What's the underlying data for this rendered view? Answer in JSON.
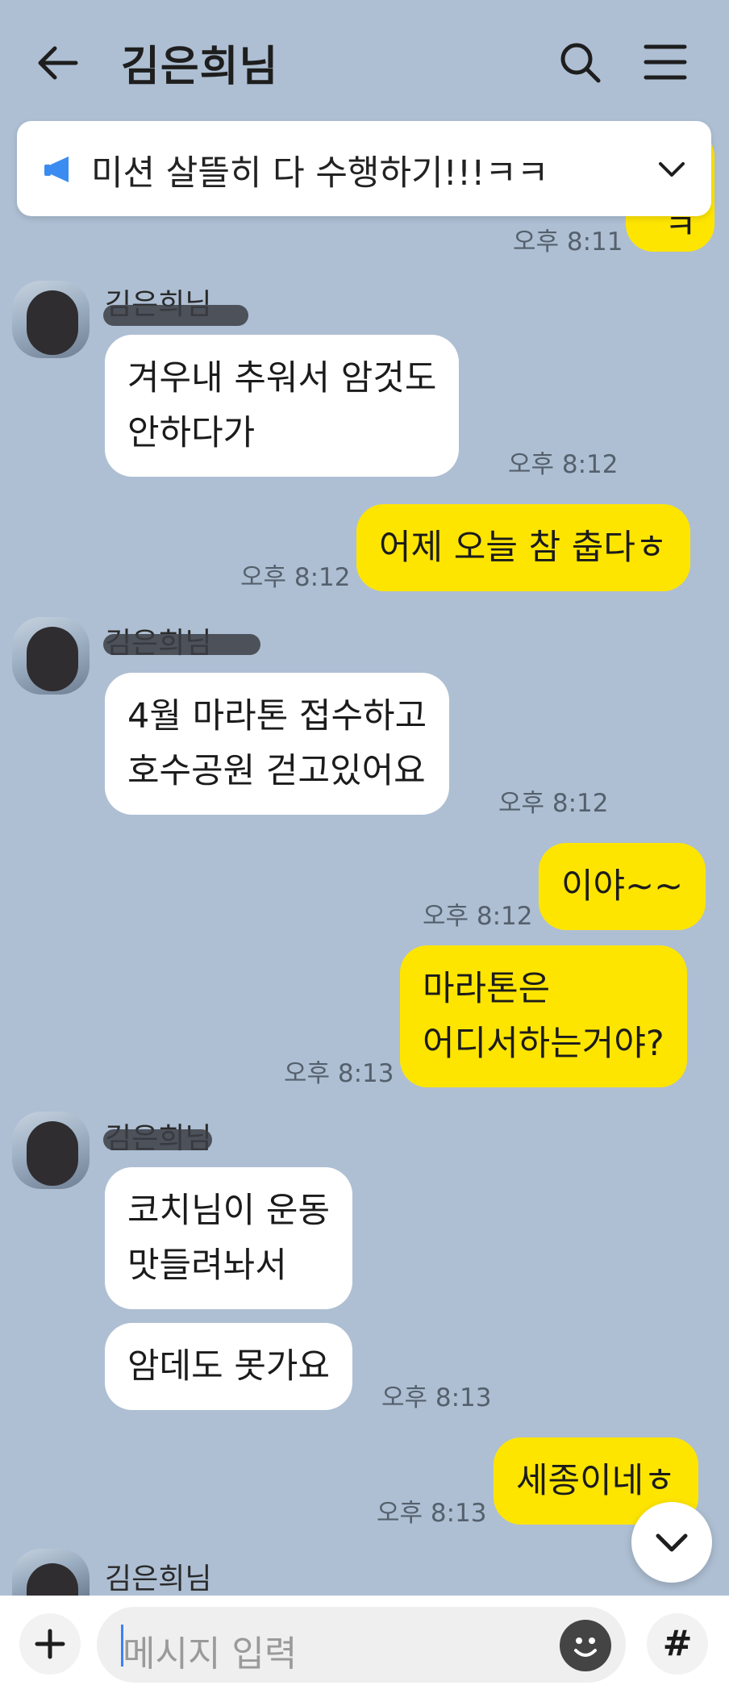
{
  "header": {
    "title": "김은희님",
    "back_icon": "arrow-left-icon",
    "search_icon": "search-icon",
    "menu_icon": "hamburger-menu-icon"
  },
  "notice": {
    "icon": "megaphone-icon",
    "text": "미션 살뜰히 다 수행하기!!!ㅋㅋ",
    "chevron": "chevron-down-icon"
  },
  "messages": [
    {
      "id": "m0",
      "sender": "me",
      "text": "ㅋ",
      "time": "오후 8:11"
    },
    {
      "id": "m1",
      "sender": "김은희님",
      "lines": [
        "겨우내 추워서 암것도",
        "안하다가"
      ],
      "time": "오후 8:12"
    },
    {
      "id": "m2",
      "sender": "me",
      "text": "어제 오늘 참 춥다ㅎ",
      "time": "오후 8:12"
    },
    {
      "id": "m3",
      "sender": "김은희님",
      "lines": [
        "4월 마라톤 접수하고",
        "호수공원 걷고있어요"
      ],
      "time": "오후 8:12"
    },
    {
      "id": "m4",
      "sender": "me",
      "text": "이야~~",
      "time": "오후 8:12"
    },
    {
      "id": "m5",
      "sender": "me",
      "lines": [
        "마라톤은",
        "어디서하는거야?"
      ],
      "time": "오후 8:13"
    },
    {
      "id": "m6",
      "sender": "김은희님",
      "lines": [
        "코치님이 운동",
        "맛들려놔서"
      ]
    },
    {
      "id": "m7",
      "sender": "김은희님",
      "text": "암데도 못가요",
      "time": "오후 8:13"
    },
    {
      "id": "m8",
      "sender": "me",
      "text": "세종이네ㅎ",
      "time": "오후 8:13"
    },
    {
      "id": "m9",
      "sender": "김은희님"
    }
  ],
  "input": {
    "plus_icon": "plus-icon",
    "placeholder": "메시지 입력",
    "emoji_icon": "emoji-icon",
    "hash_label": "#"
  },
  "scroll_down_icon": "chevron-down-icon",
  "colors": {
    "background": "#aebfd3",
    "my_bubble": "#fee500",
    "their_bubble": "#ffffff",
    "notice_icon": "#3b8cf0"
  }
}
